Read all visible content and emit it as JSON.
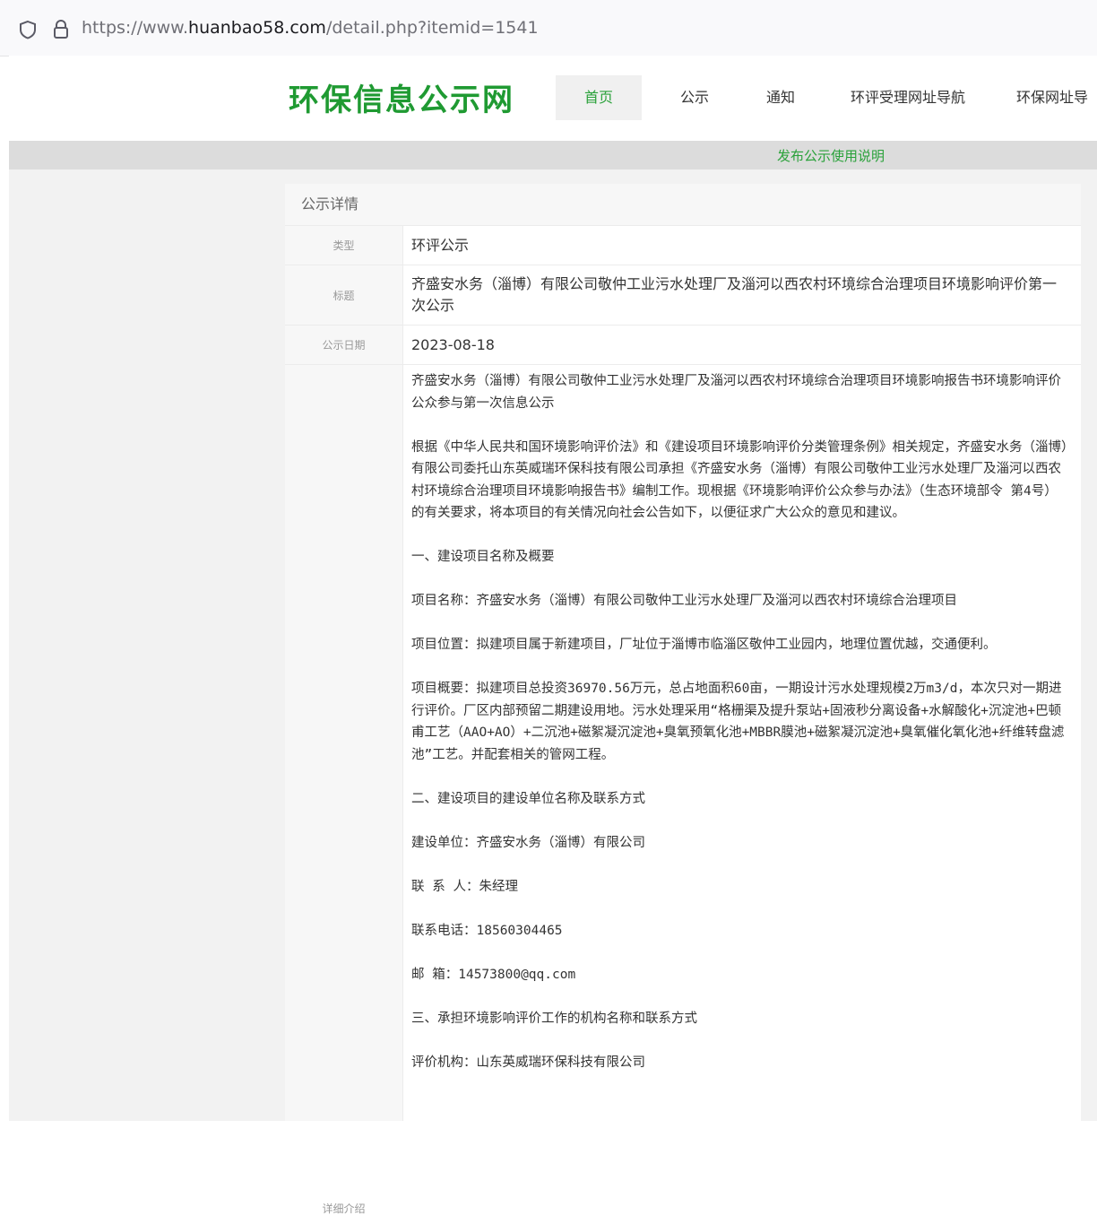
{
  "browser": {
    "url_prefix": "https://www.",
    "url_domain": "huanbao58.com",
    "url_path": "/detail.php?itemid=1541"
  },
  "header": {
    "logo": "环保信息公示网",
    "nav": [
      "首页",
      "公示",
      "通知",
      "环评受理网址导航",
      "环保网址导"
    ],
    "active_nav": "首页",
    "accent_color": "#2aa13a"
  },
  "subbar": {
    "link": "发布公示使用说明"
  },
  "card": {
    "title": "公示详情",
    "type_label": "类型",
    "type_value": "环评公示",
    "title_label": "标题",
    "title_value": "齐盛安水务（淄博）有限公司敬仲工业污水处理厂及淄河以西农村环境综合治理项目环境影响评价第一次公示",
    "date_label": "公示日期",
    "date_value": "2023-08-18",
    "detail_label": "详细介绍",
    "paragraphs": [
      "齐盛安水务（淄博）有限公司敬仲工业污水处理厂及淄河以西农村环境综合治理项目环境影响报告书环境影响评价公众参与第一次信息公示",
      "根据《中华人民共和国环境影响评价法》和《建设项目环境影响评价分类管理条例》相关规定，齐盛安水务（淄博）有限公司委托山东英威瑞环保科技有限公司承担《齐盛安水务（淄博）有限公司敬仲工业污水处理厂及淄河以西农村环境综合治理项目环境影响报告书》编制工作。现根据《环境影响评价公众参与办法》（生态环境部令 第4号）的有关要求，将本项目的有关情况向社会公告如下，以便征求广大公众的意见和建议。",
      "一、建设项目名称及概要",
      "项目名称：齐盛安水务（淄博）有限公司敬仲工业污水处理厂及淄河以西农村环境综合治理项目",
      "项目位置：拟建项目属于新建项目，厂址位于淄博市临淄区敬仲工业园内，地理位置优越，交通便利。",
      "项目概要：拟建项目总投资36970.56万元，总占地面积60亩，一期设计污水处理规模2万m3/d，本次只对一期进行评价。厂区内部预留二期建设用地。污水处理采用“格栅渠及提升泵站+固液秒分离设备+水解酸化+沉淀池+巴顿甫工艺（AAO+AO）+二沉池+磁絮凝沉淀池+臭氧预氧化池+MBBR膜池+磁絮凝沉淀池+臭氧催化氧化池+纤维转盘滤池”工艺。并配套相关的管网工程。",
      "二、建设项目的建设单位名称及联系方式",
      "建设单位：齐盛安水务（淄博）有限公司",
      "联 系 人：朱经理",
      "联系电话：18560304465",
      "邮 箱：14573800@qq.com",
      "三、承担环境影响评价工作的机构名称和联系方式",
      "评价机构：山东英威瑞环保科技有限公司"
    ]
  }
}
